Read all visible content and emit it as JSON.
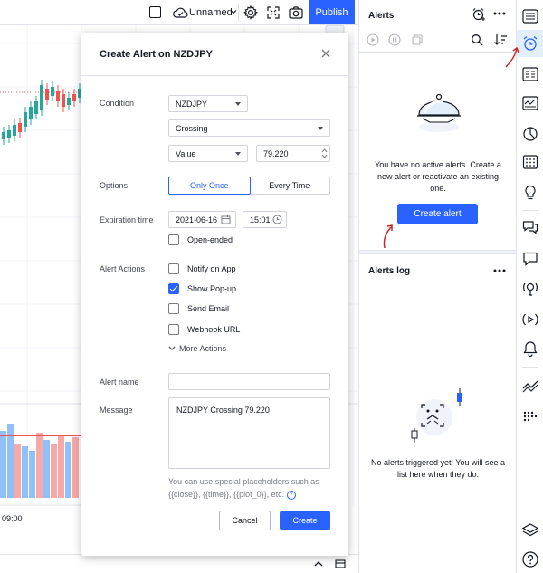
{
  "toolbar": {
    "layout_name": "Unnamed",
    "publish_label": "Publish"
  },
  "chart": {
    "time_label": "09:00"
  },
  "modal": {
    "title": "Create Alert on NZDJPY",
    "condition_label": "Condition",
    "symbol_value": "NZDJPY",
    "operator_value": "Crossing",
    "target_value": "Value",
    "price_value": "79.220",
    "options_label": "Options",
    "option_once": "Only Once",
    "option_every": "Every Time",
    "expiration_label": "Expiration time",
    "expiration_date": "2021-06-16",
    "expiration_time": "15:01",
    "open_ended_label": "Open-ended",
    "actions_label": "Alert Actions",
    "actions": [
      {
        "label": "Notify on App",
        "checked": false
      },
      {
        "label": "Show Pop-up",
        "checked": true
      },
      {
        "label": "Send Email",
        "checked": false
      },
      {
        "label": "Webhook URL",
        "checked": false
      }
    ],
    "more_actions": "More Actions",
    "alert_name_label": "Alert name",
    "alert_name_value": "",
    "message_label": "Message",
    "message_value": "NZDJPY Crossing 79.220",
    "hint": "You can use special placeholders such as {{close}}, {{time}}, {{plot_0}}, etc.",
    "cancel_label": "Cancel",
    "create_label": "Create"
  },
  "alerts_panel": {
    "title": "Alerts",
    "empty_text": "You have no active alerts. Create a new alert or reactivate an existing one.",
    "create_alert_label": "Create alert",
    "log_title": "Alerts log",
    "log_empty_text": "No alerts triggered yet! You will see a list here when they do."
  },
  "colors": {
    "accent": "#2962ff",
    "bull": "#26a69a",
    "bear": "#ef5350",
    "annotation_arrow": "#c62828"
  },
  "icons": {
    "sidebar": [
      "watchlist-icon",
      "alarm-clock-icon",
      "data-window-icon",
      "hotlist-icon",
      "pie-chart-icon",
      "calendar-icon",
      "idea-lightbulb-icon",
      "chat-icon",
      "comment-icon",
      "streams-icon",
      "broadcast-icon",
      "notifications-bell-icon",
      "trend-lines-icon",
      "dots-grid-icon",
      "layers-icon",
      "help-icon"
    ]
  }
}
